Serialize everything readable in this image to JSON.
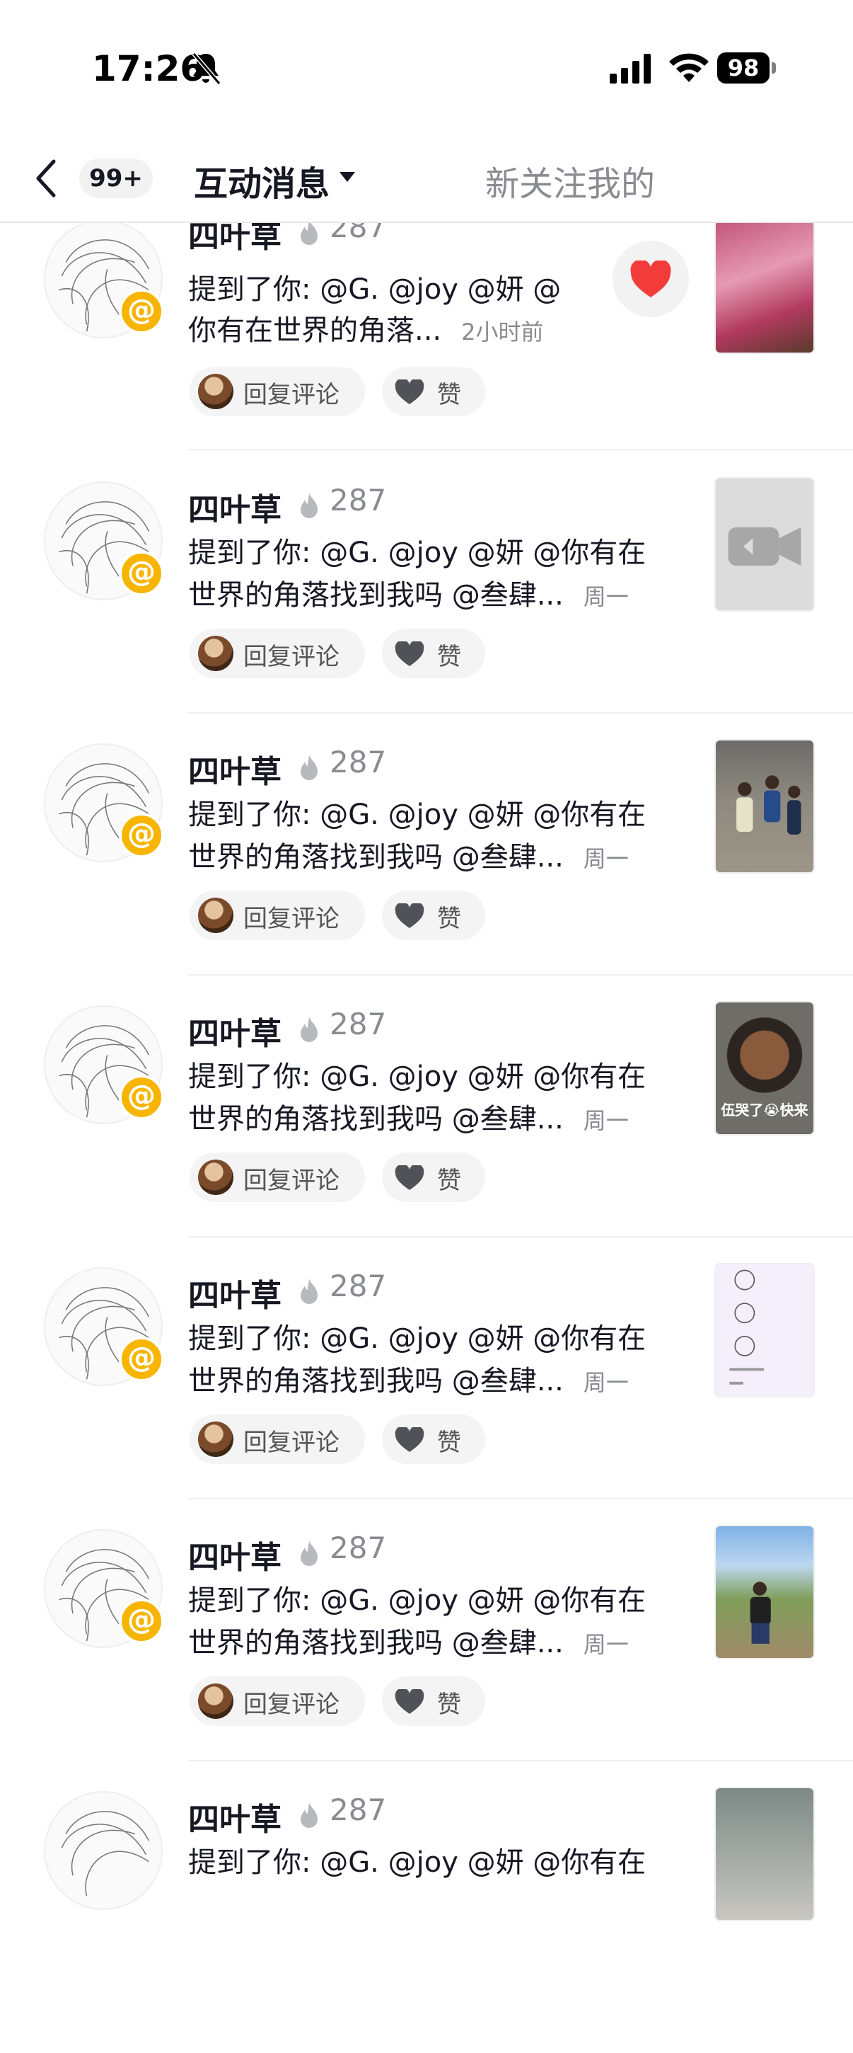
{
  "status_bar": {
    "time": "17:26",
    "battery": "98"
  },
  "nav": {
    "badge": "99+",
    "tab_active": "互动消息",
    "tab_other": "新关注我的"
  },
  "items": [
    {
      "name": "四叶草",
      "score": "287",
      "line1": "提到了你: @G. @joy @妍 @",
      "line2": "你有在世界的角落...",
      "time": "2小时前",
      "reply": "回复评论",
      "like": "赞"
    },
    {
      "name": "四叶草",
      "score": "287",
      "line1": "提到了你: @G. @joy @妍 @你有在",
      "line2": "世界的角落找到我吗 @叁肆...",
      "time": "周一",
      "reply": "回复评论",
      "like": "赞"
    },
    {
      "name": "四叶草",
      "score": "287",
      "line1": "提到了你: @G. @joy @妍 @你有在",
      "line2": "世界的角落找到我吗 @叁肆...",
      "time": "周一",
      "reply": "回复评论",
      "like": "赞"
    },
    {
      "name": "四叶草",
      "score": "287",
      "line1": "提到了你: @G. @joy @妍 @你有在",
      "line2": "世界的角落找到我吗 @叁肆...",
      "time": "周一",
      "reply": "回复评论",
      "like": "赞",
      "thumb_caption": "伍哭了😭快来"
    },
    {
      "name": "四叶草",
      "score": "287",
      "line1": "提到了你: @G. @joy @妍 @你有在",
      "line2": "世界的角落找到我吗 @叁肆...",
      "time": "周一",
      "reply": "回复评论",
      "like": "赞"
    },
    {
      "name": "四叶草",
      "score": "287",
      "line1": "提到了你: @G. @joy @妍 @你有在",
      "line2": "世界的角落找到我吗 @叁肆...",
      "time": "周一",
      "reply": "回复评论",
      "like": "赞"
    },
    {
      "name": "四叶草",
      "score": "287",
      "line1": "提到了你: @G. @joy @妍 @你有在",
      "line2": "",
      "time": "",
      "reply": "",
      "like": ""
    }
  ],
  "icons": {
    "back": "back-chevron-icon",
    "bell": "bell-mute-icon",
    "signal": "signal-icon",
    "wifi": "wifi-icon",
    "fire": "fire-icon",
    "heart": "heart-icon",
    "at": "at-icon",
    "video": "video-placeholder-icon"
  },
  "colors": {
    "accent_heart": "#f23c3c",
    "at_badge": "#f7b500",
    "secondary_text": "#8a8b91"
  }
}
